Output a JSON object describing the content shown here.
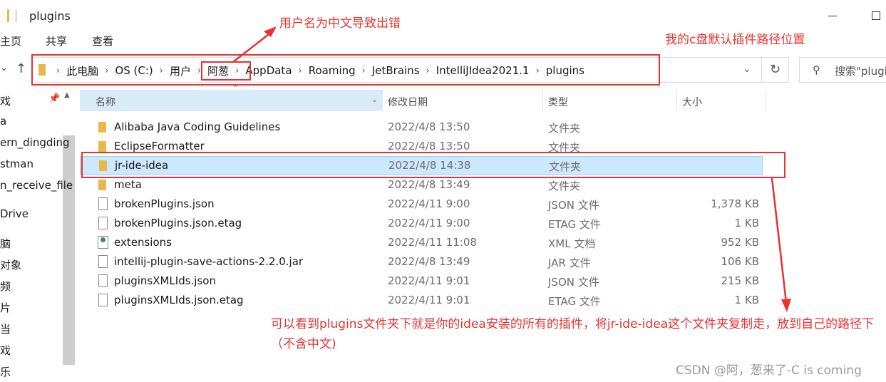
{
  "window": {
    "title": "plugins"
  },
  "ribbon": {
    "tabs": [
      "主页",
      "共享",
      "查看"
    ]
  },
  "address": {
    "crumbs": [
      "此电脑",
      "OS (C:)",
      "用户",
      "阿葱",
      "AppData",
      "Roaming",
      "JetBrains",
      "IntelliJIdea2021.1",
      "plugins"
    ],
    "search_placeholder": "搜索\"plugins\""
  },
  "sidebar": {
    "items": [
      "戏",
      "a",
      "ern_dingding",
      "stman",
      "n_receive_file",
      "Drive",
      "脑",
      "对象",
      "频",
      "片",
      "当",
      "戏",
      "乐"
    ]
  },
  "columns": {
    "name": "名称",
    "date": "修改日期",
    "type": "类型",
    "size": "大小"
  },
  "files": [
    {
      "name": "Alibaba Java Coding Guidelines",
      "date": "2022/4/8 13:50",
      "type": "文件夹",
      "size": "",
      "kind": "folder"
    },
    {
      "name": "EclipseFormatter",
      "date": "2022/4/8 13:50",
      "type": "文件夹",
      "size": "",
      "kind": "folder"
    },
    {
      "name": "jr-ide-idea",
      "date": "2022/4/8 14:38",
      "type": "文件夹",
      "size": "",
      "kind": "folder",
      "selected": true
    },
    {
      "name": "meta",
      "date": "2022/4/8 13:49",
      "type": "文件夹",
      "size": "",
      "kind": "folder"
    },
    {
      "name": "brokenPlugins.json",
      "date": "2022/4/11 9:00",
      "type": "JSON 文件",
      "size": "1,378 KB",
      "kind": "file"
    },
    {
      "name": "brokenPlugins.json.etag",
      "date": "2022/4/11 9:00",
      "type": "ETAG 文件",
      "size": "1 KB",
      "kind": "file"
    },
    {
      "name": "extensions",
      "date": "2022/4/11 11:08",
      "type": "XML 文档",
      "size": "952 KB",
      "kind": "xml"
    },
    {
      "name": "intellij-plugin-save-actions-2.2.0.jar",
      "date": "2022/4/8 13:49",
      "type": "JAR 文件",
      "size": "106 KB",
      "kind": "file"
    },
    {
      "name": "pluginsXMLIds.json",
      "date": "2022/4/11 9:01",
      "type": "JSON 文件",
      "size": "215 KB",
      "kind": "file"
    },
    {
      "name": "pluginsXMLIds.json.etag",
      "date": "2022/4/11 9:01",
      "type": "ETAG 文件",
      "size": "1 KB",
      "kind": "file"
    }
  ],
  "annotations": {
    "username_note": "用户名为中文导致出错",
    "path_note": "我的c盘默认插件路径位置",
    "instruction": "可以看到plugins文件夹下就是你的idea安装的所有的插件，将jr-ide-idea这个文件夹复制走，放到自己的路径下（不含中文)",
    "color": "#e8322f"
  },
  "watermark": "CSDN @阿，葱来了-C is coming"
}
